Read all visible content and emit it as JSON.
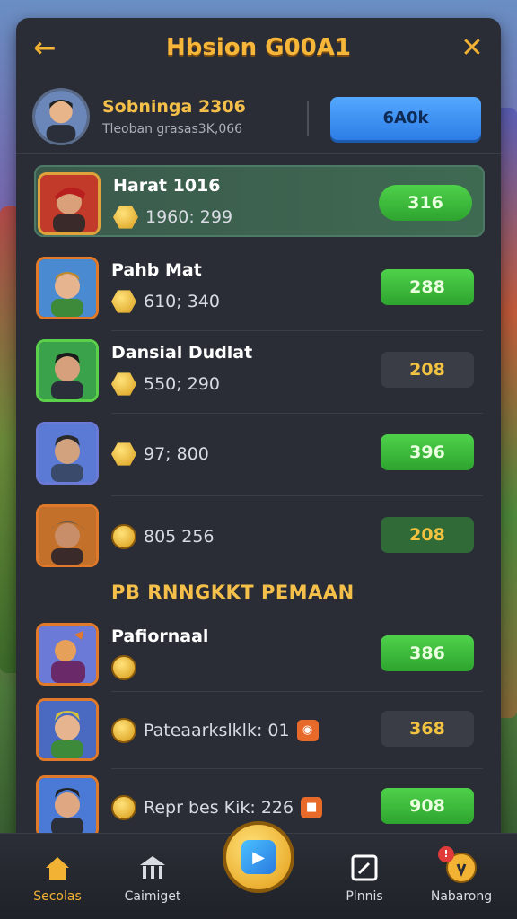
{
  "header": {
    "title": "Hbsion G00A1",
    "back_icon": "arrow-left-icon",
    "close_icon": "close-icon"
  },
  "profile": {
    "name": "Sobninga 2306",
    "subtitle": "Tleoban grasas3K,066",
    "button_label": "6A0k"
  },
  "leaderboard": [
    {
      "name": "Harat 1016",
      "stats": "1960: 299",
      "score": "316",
      "highlight": true
    },
    {
      "name": "Pahb Mat",
      "stats": "610; 340",
      "score": "288"
    },
    {
      "name": "Dansial Dudlat",
      "stats": "550; 290",
      "score": "208"
    },
    {
      "name": "",
      "stats": "97; 800",
      "score": "396"
    },
    {
      "name": "",
      "stats": "805 256",
      "score": "208"
    }
  ],
  "section": {
    "title": "PB RNNGKKT PEMAAN"
  },
  "second_list": [
    {
      "name": "Pafiornaal",
      "stats": "",
      "score": "386"
    },
    {
      "name": "",
      "stats": "Pateaarkslklk: 01",
      "score": "368"
    },
    {
      "name": "",
      "stats": "Repr bes Kik: 226",
      "score": "908"
    }
  ],
  "navbar": {
    "items": [
      {
        "label": "Secolas",
        "icon": "home-icon"
      },
      {
        "label": "Caimiget",
        "icon": "building-icon"
      },
      {
        "label": "",
        "icon": "play-icon"
      },
      {
        "label": "Plnnis",
        "icon": "edit-icon"
      },
      {
        "label": "Nabarong",
        "icon": "badge-icon"
      }
    ]
  },
  "colors": {
    "accent": "#f2b233",
    "panel": "#2a2d35",
    "green": "#4ed14a",
    "blue": "#3d8ef0"
  }
}
